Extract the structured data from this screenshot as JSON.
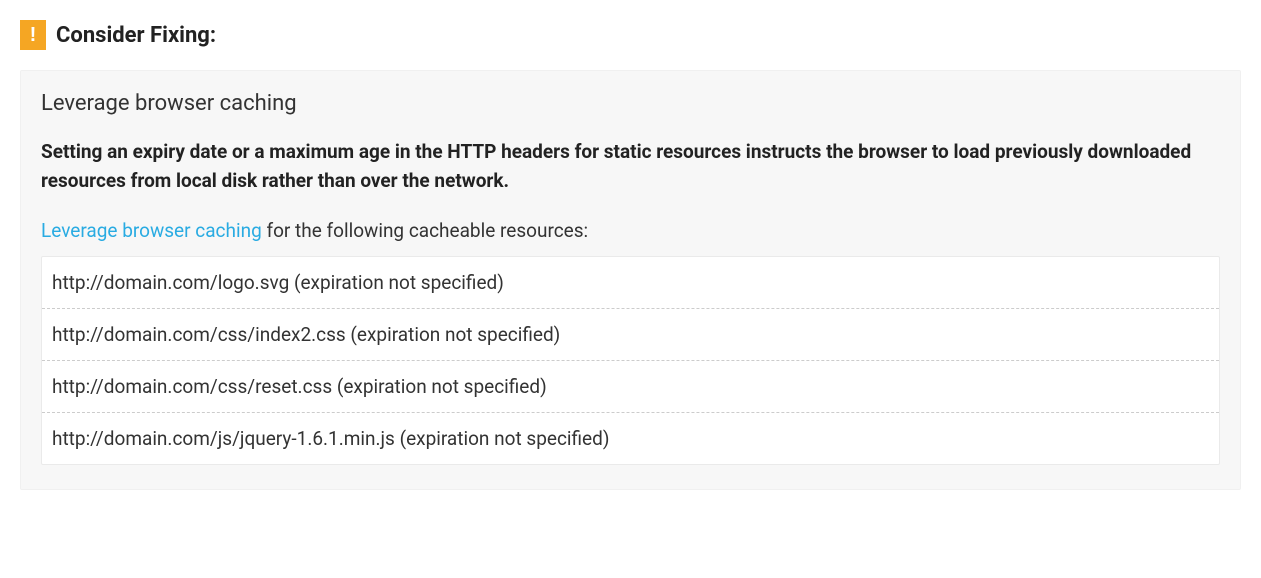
{
  "header": {
    "title": "Consider Fixing:"
  },
  "rule": {
    "title": "Leverage browser caching",
    "description": "Setting an expiry date or a maximum age in the HTTP headers for static resources instructs the browser to load previously downloaded resources from local disk rather than over the network.",
    "link_text": "Leverage browser caching",
    "instruction_suffix": " for the following cacheable resources:"
  },
  "resources": [
    "http://domain.com/logo.svg (expiration not specified)",
    "http://domain.com/css/index2.css (expiration not specified)",
    "http://domain.com/css/reset.css (expiration not specified)",
    "http://domain.com/js/jquery-1.6.1.min.js (expiration not specified)"
  ]
}
